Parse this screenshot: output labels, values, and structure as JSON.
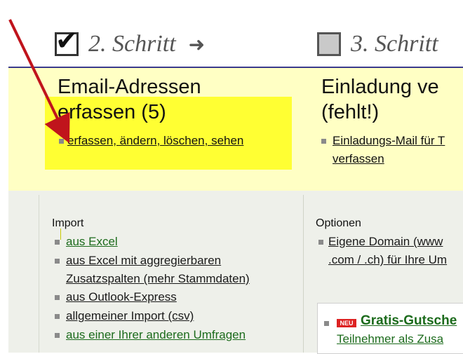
{
  "steps": {
    "step2": {
      "label": "2. Schritt",
      "checked": true
    },
    "step3": {
      "label": "3. Schritt",
      "checked": false
    }
  },
  "columns": {
    "left": {
      "title_line1": "Email-Adressen",
      "title_line2": "erfassen (5)",
      "link": "erfassen, ändern, löschen, sehen"
    },
    "right": {
      "title_line1": "Einladung ve",
      "title_line2": "(fehlt!)",
      "link_line1": "Einladungs-Mail für T",
      "link_line2": "verfassen"
    }
  },
  "import": {
    "label": "Import",
    "items": [
      "aus Excel",
      "aus Excel mit aggregierbaren",
      "Zusatzspalten (mehr Stammdaten)",
      "aus Outlook-Express",
      "allgemeiner Import (csv)",
      "aus einer Ihrer anderen Umfragen"
    ]
  },
  "options": {
    "label": "Optionen",
    "line1": "Eigene Domain (www",
    "line2": ".com / .ch) für Ihre Um"
  },
  "promo": {
    "badge": "NEU",
    "title": "Gratis-Gutsche",
    "subtitle": "Teilnehmer als Zusa"
  },
  "colors": {
    "band_bg": "#ffffc4",
    "highlight": "#ffff33",
    "panel_bg": "#eef0ea",
    "link_green": "#1c6b1c",
    "arrow_red": "#c0141c"
  }
}
